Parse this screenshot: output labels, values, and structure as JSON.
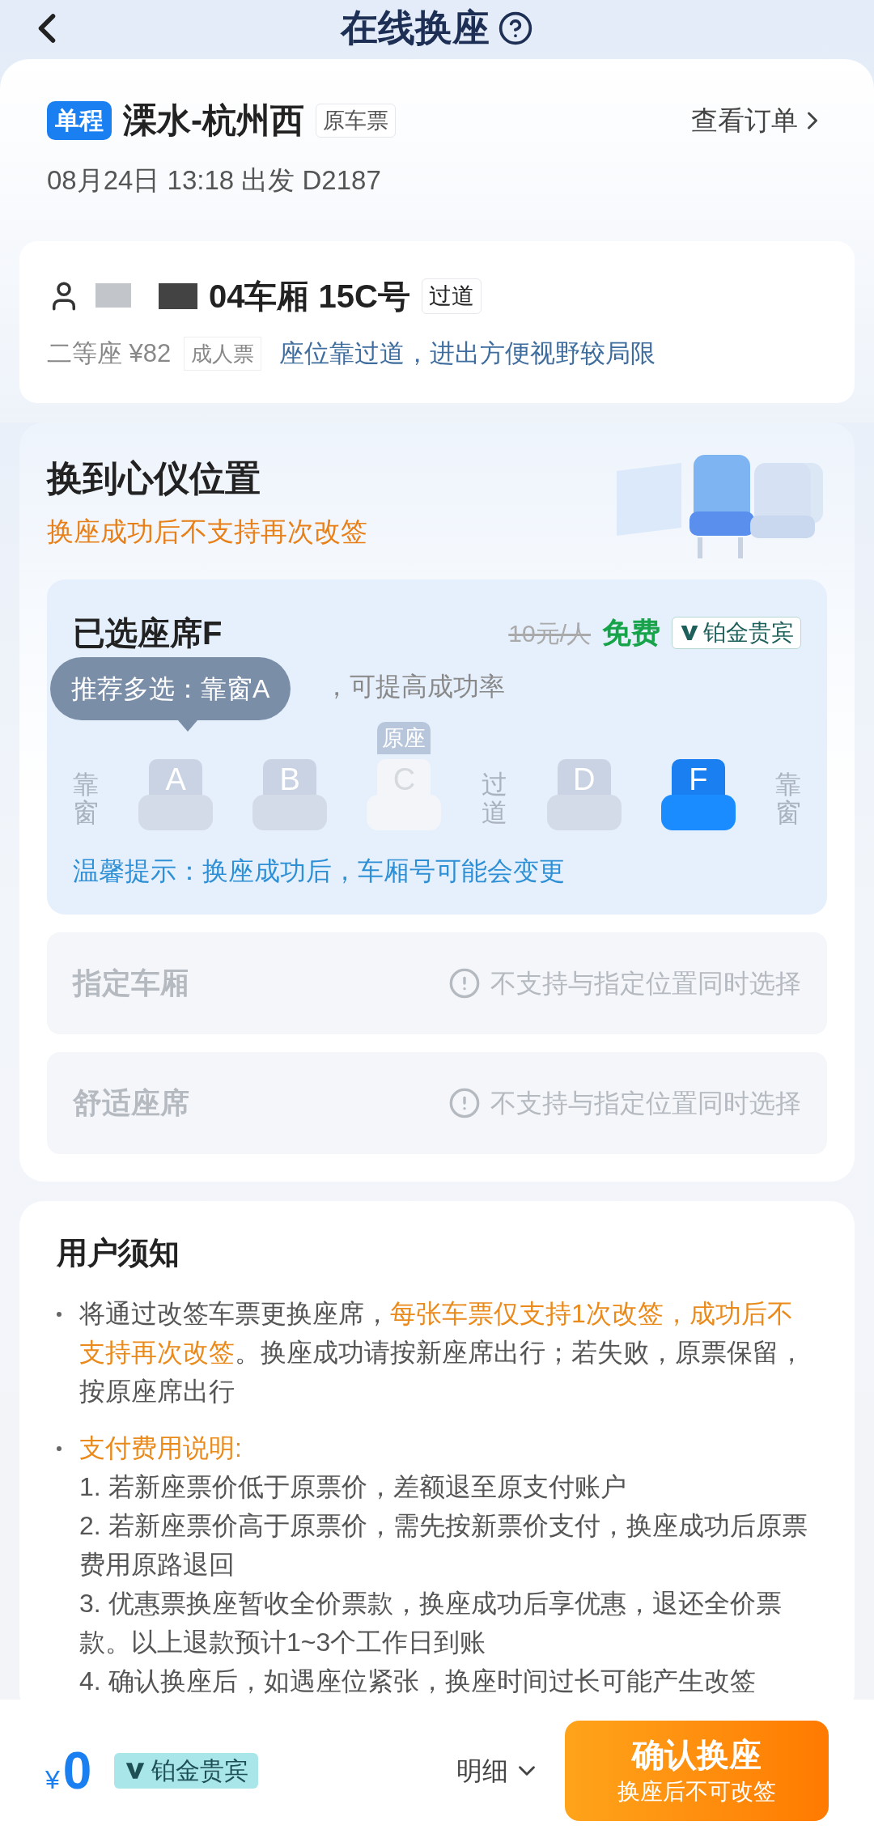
{
  "header": {
    "title": "在线换座"
  },
  "trip": {
    "badge": "单程",
    "route": "溧水-杭州西",
    "tag": "原车票",
    "order_link": "查看订单",
    "departure": "08月24日 13:18 出发 D2187"
  },
  "passenger": {
    "seat": "04车厢 15C号",
    "seat_tag": "过道",
    "class": "二等座 ¥82",
    "ticket_type": "成人票",
    "seat_note": "座位靠过道，进出方便视野较局限"
  },
  "change": {
    "title": "换到心仪位置",
    "warning": "换座成功后不支持再次改签",
    "selected_label": "已选座席F",
    "old_price": "10元/人",
    "price": "免费",
    "vip_badge": "铂金贵宾",
    "hint": "，可提高成功率",
    "tooltip": "推荐多选：靠窗A",
    "tip": "温馨提示：换座成功后，车厢号可能会变更",
    "seats": [
      {
        "kind": "label",
        "text": "靠窗"
      },
      {
        "kind": "seat",
        "letter": "A",
        "selected": false,
        "original": false
      },
      {
        "kind": "seat",
        "letter": "B",
        "selected": false,
        "original": false
      },
      {
        "kind": "seat",
        "letter": "C",
        "selected": false,
        "original": true,
        "badge": "原座"
      },
      {
        "kind": "label",
        "text": "过道"
      },
      {
        "kind": "seat",
        "letter": "D",
        "selected": false,
        "original": false
      },
      {
        "kind": "seat",
        "letter": "F",
        "selected": true,
        "original": false
      },
      {
        "kind": "label",
        "text": "靠窗"
      }
    ]
  },
  "options": [
    {
      "label": "指定车厢",
      "note": "不支持与指定位置同时选择",
      "disabled": true
    },
    {
      "label": "舒适座席",
      "note": "不支持与指定位置同时选择",
      "disabled": true
    }
  ],
  "notice": {
    "title": "用户须知",
    "items": [
      {
        "kind": "paragraph",
        "segments": [
          {
            "text": "将通过改签车票更换座席，",
            "highlight": false
          },
          {
            "text": "每张车票仅支持1次改签，成功后不支持再次改签",
            "highlight": true
          },
          {
            "text": "。换座成功请按新座席出行；若失败，原票保留，按原座席出行",
            "highlight": false
          }
        ]
      },
      {
        "kind": "list",
        "heading": "支付费用说明:",
        "lines": [
          "1. 若新座票价低于原票价，差额退至原支付账户",
          "2. 若新座票价高于原票价，需先按新票价支付，换座成功后原票费用原路退回",
          "3. 优惠票换座暂收全价票款，换座成功后享优惠，退还全价票款。以上退款预计1~3个工作日到账",
          "4. 确认换座后，如遇座位紧张，换座时间过长可能产生改签"
        ]
      }
    ]
  },
  "bottom": {
    "currency": "¥",
    "amount": "0",
    "vip_badge": "铂金贵宾",
    "details": "明细",
    "confirm": "确认换座",
    "confirm_sub": "换座后不可改签"
  }
}
